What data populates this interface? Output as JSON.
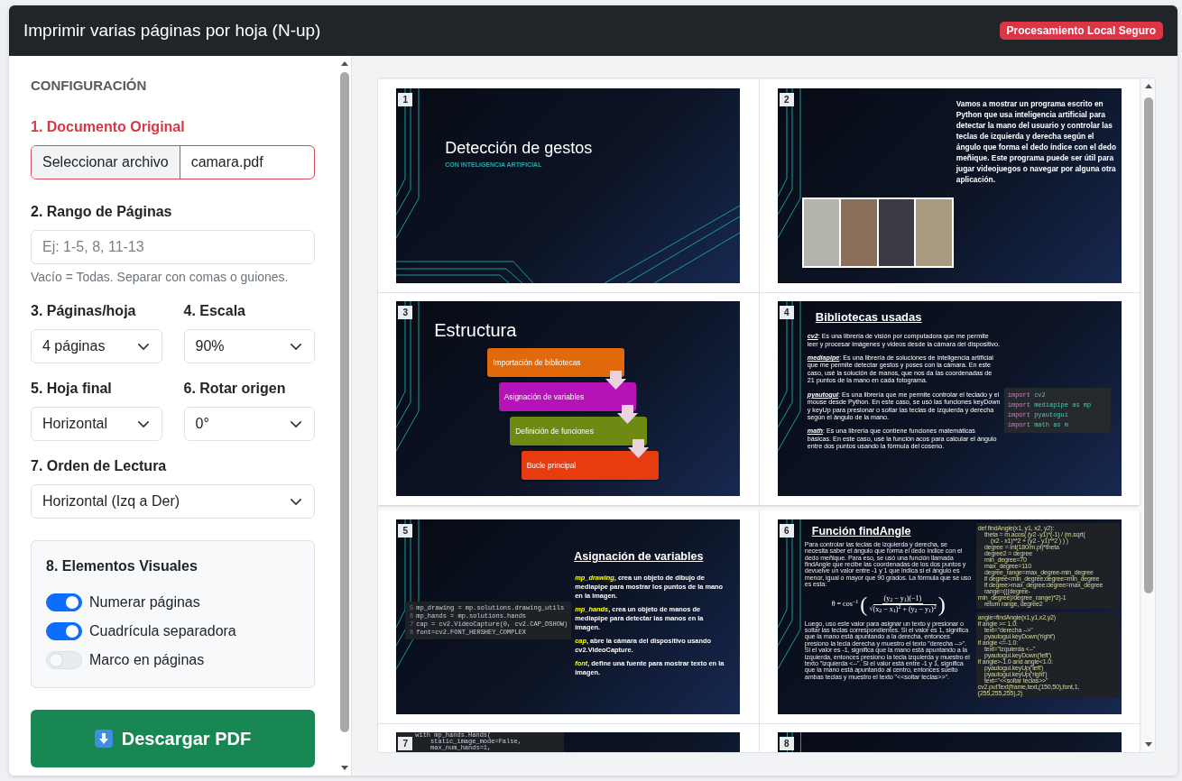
{
  "header": {
    "title": "Imprimir varias páginas por hoja (N-up)",
    "badge": "Procesamiento Local Seguro"
  },
  "settings": {
    "heading": "CONFIGURACIÓN",
    "document": {
      "label": "1. Documento Original",
      "button": "Seleccionar archivo",
      "file_name": "camara.pdf"
    },
    "page_range": {
      "label": "2. Rango de Páginas",
      "placeholder": "Ej: 1-5, 8, 11-13",
      "hint": "Vacío = Todas. Separar con comas o guiones."
    },
    "select_rows": [
      [
        {
          "label": "3. Páginas/hoja",
          "value": "4 páginas"
        },
        {
          "label": "4. Escala",
          "value": "90%"
        }
      ],
      [
        {
          "label": "5. Hoja final",
          "value": "Horizontal"
        },
        {
          "label": "6. Rotar origen",
          "value": "0°"
        }
      ],
      [
        {
          "label": "7. Orden de Lectura",
          "value": "Horizontal (Izq a Der)"
        }
      ]
    ],
    "visual_elements": {
      "title": "8. Elementos Visuales",
      "toggles": [
        {
          "label": "Numerar páginas",
          "on": true
        },
        {
          "label": "Cuadrícula separadora",
          "on": true
        },
        {
          "label": "Marco en páginas",
          "on": false
        }
      ]
    },
    "download_button": "Descargar PDF"
  },
  "preview": {
    "sheets": [
      {
        "slides": [
          {
            "number": "1",
            "kind": "title",
            "title": "Detección de gestos",
            "subtitle": "CON INTELIGENCIA ARTIFICIAL"
          },
          {
            "number": "2",
            "kind": "text_photos",
            "text": "Vamos a mostrar un programa escrito en Python que usa inteligencia artificial para detectar la mano del usuario y controlar las teclas de izquierda y derecha según el ángulo que forma el dedo índice con el dedo meñique. Este programa puede ser útil para jugar videojuegos o navegar por alguna otra aplicación."
          },
          {
            "number": "3",
            "kind": "flowchart",
            "title": "Estructura",
            "steps": [
              {
                "label": "Importación de bibliotecas",
                "color": "#e2680c"
              },
              {
                "label": "Asignación de variables",
                "color": "#b512b8"
              },
              {
                "label": "Definición de funciones",
                "color": "#6e8a12"
              },
              {
                "label": "Bucle principal",
                "color": "#e63c10"
              }
            ]
          },
          {
            "number": "4",
            "kind": "libraries",
            "title": "Bibliotecas usadas",
            "items": [
              {
                "term": "cv2",
                "text": ": Es una librería de visión por computadora que me permite leer y procesar imágenes y videos desde la cámara del dispositivo."
              },
              {
                "term": "mediapipe",
                "text": ": Es una librería de soluciones de inteligencia artificial que me permite detectar gestos y poses con la cámara. En este caso, usé la solución de manos, que nos da las coordenadas de 21 puntos de la mano en cada fotograma."
              },
              {
                "term": "pyautogui",
                "text": ": Es una librería que me permite controlar el teclado y el mouse desde Python. En este caso, se usó las funciones keyDown y keyUp para presionar o soltar las teclas de izquierda y derecha según el ángulo de la mano."
              },
              {
                "term": "math",
                "text": ": Es una librería que contiene funciones matemáticas básicas. En este caso, usé la función acos para calcular el ángulo entre dos puntos usando la fórmula del coseno."
              }
            ],
            "code": [
              {
                "keyword": "import",
                "rest": " cv2"
              },
              {
                "keyword": "import",
                "rest": " mediapipe as mp"
              },
              {
                "keyword": "import",
                "rest": " pyautogui"
              },
              {
                "keyword": "import",
                "rest": " math as m"
              }
            ]
          }
        ]
      },
      {
        "slides": [
          {
            "number": "5",
            "kind": "variables",
            "title": "Asignación de variables",
            "code": [
              {
                "line": "5",
                "text": "mp_drawing = mp.solutions.drawing_utils"
              },
              {
                "line": "6",
                "text": "mp_hands = mp.solutions.hands"
              },
              {
                "line": "7",
                "text": "cap = cv2.VideoCapture(0, cv2.CAP_DSHOW)"
              },
              {
                "line": "8",
                "text": "font=cv2.FONT_HERSHEY_COMPLEX"
              }
            ],
            "items": [
              {
                "term": "mp_drawing",
                "text": ", crea un objeto de dibujo de mediapipe para mostrar los puntos de la mano en la imagen."
              },
              {
                "term": "mp_hands",
                "text": ", crea un objeto de manos de mediapipe para detectar las manos en la imagen."
              },
              {
                "term": "cap",
                "text": ", abre la cámara del dispositivo usando cv2.VideoCapture."
              },
              {
                "term": "font",
                "text": ", define una fuente para mostrar texto en la imagen."
              }
            ]
          },
          {
            "number": "6",
            "kind": "function",
            "title": "Función findAngle",
            "intro": "Para controlar las teclas de izquierda y derecha, se necesita saber el ángulo que forma el dedo índice con el dedo meñique. Para eso, se usó una función llamada findAngle que recibe las coordenadas de los dos puntos y devuelve un valor entre -1 y 1 que indica si el ángulo es menor, igual o mayor que 90 grados. La fórmula que se uso es esta:",
            "formula": {
              "lhs": "θ = cos$^{−1}$",
              "open": "(",
              "numerator": "(y$_{2}$ − y$_{1}$)(−1)",
              "radical": "√",
              "denominator": "(x$_{2}$ − x$_{1}$)$^{2}$ + (y$_{2}$ − y$_{1}$)$^{2}$",
              "close": ")"
            },
            "explanation": "Luego, uso este valor para asignar un texto y presionar o soltar las teclas correspondientes. Si el valor es 1, significa que la mano está apuntando a la derecha, entonces presiono la tecla derecha y muestro el texto \"derecha -->\". Si el valor es -1, significa que la mano está apuntando a la izquierda, entonces presiono la tecla izquierda y muestro el texto \"izquierda <--\". Si el valor está entre -1 y 1, significa que la mano está apuntando al centro, entonces suelto ambas teclas y muestro el texto \"<<soltar teclas>>\".",
            "code_blocks": [
              [
                "def findAngle(x1, y1, x2, y2):",
                "    theta = m.acos( (y2 -y1)*(-1) / (m.sqrt(",
                "        (x2 - x1)**2 + (y2 - y1)**2 ) ) )",
                "    degree = int(180/m.pi)*theta",
                "    degree2 = degree",
                "    min_degree=70",
                "    max_degree=110",
                "    degree_range=max_degree-min_degree",
                "    if degree<min_degree:degree=min_degree",
                "    if degree>max_degree:degree=max_degree",
                "    range=(((degree-min_degree)/degree_range)*2)-1",
                "    return range, degree2"
              ],
              [
                "angle=findAngle(x1,y1,x2,y2)",
                "if angle >= 1.0:",
                "    text=\"derecha -->\"",
                "    pyautogui.keyDown('right')",
                "if angle <=-1.0:",
                "    text=\"izquierda <--\"",
                "    pyautogui.keyDown('left')",
                "if angle>-1.0 and angle<1.0:",
                "    pyautogui.keyUp('left')",
                "    pyautogui.keyUp('right')",
                "    text=\"<<soltar teclas>>\"",
                "cv2.putText(frame,text,(150,50),font,1,(255,255,255),2)"
              ]
            ]
          },
          {
            "number": "7",
            "kind": "code_top",
            "code": [
              "with mp_hands.Hands(",
              "    static_image_mode=False,",
              "    max_num_hands=1,"
            ]
          },
          {
            "number": "8",
            "kind": "blank"
          }
        ]
      }
    ]
  }
}
